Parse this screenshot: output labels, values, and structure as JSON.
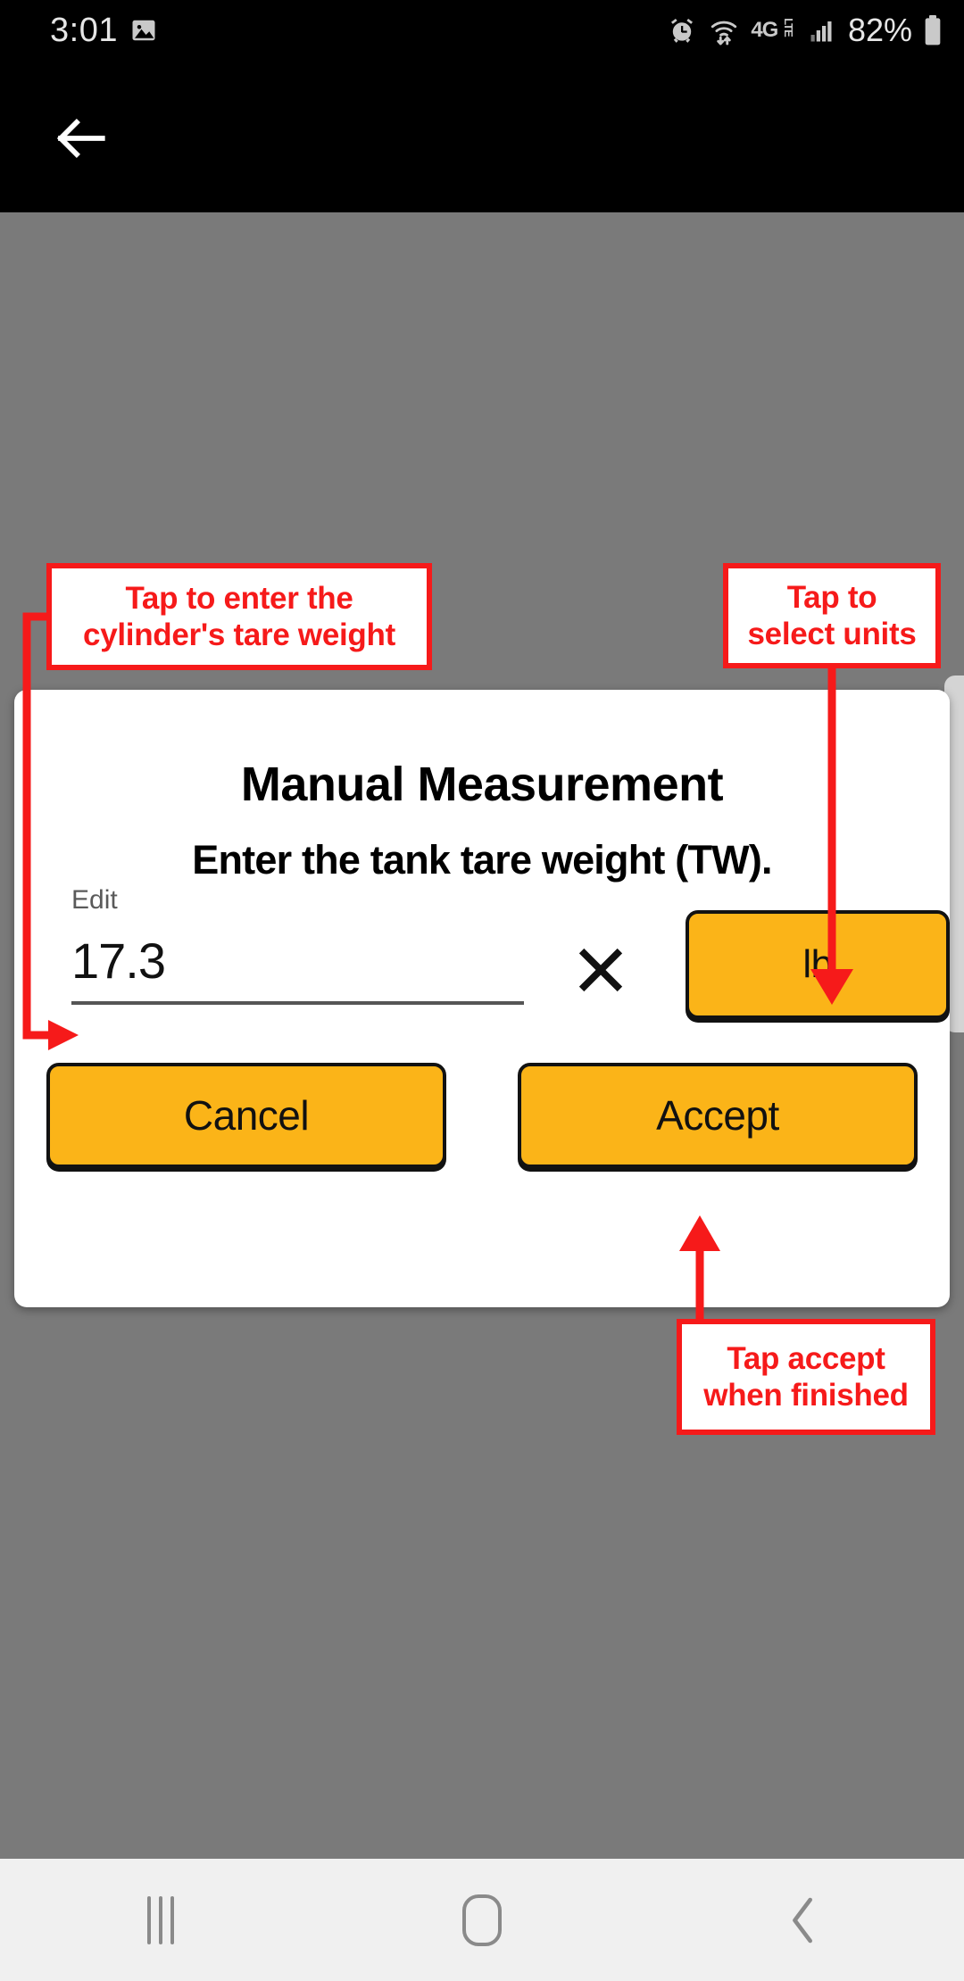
{
  "status_bar": {
    "time": "3:01",
    "battery_percent": "82%",
    "network_label": "4G",
    "network_sub": "LTE",
    "icons": [
      "image-icon",
      "alarm-icon",
      "wifi-icon",
      "network-4glte-icon",
      "signal-bars-icon",
      "battery-icon"
    ]
  },
  "app_bar": {
    "back_icon": "back-arrow-icon"
  },
  "dialog": {
    "title": "Manual Measurement",
    "subtitle": "Enter the tank tare weight (TW).",
    "field_label": "Edit",
    "field_value": "17.3",
    "field_placeholder": "",
    "clear_icon": "close-x-icon",
    "unit_value": "lb",
    "cancel_label": "Cancel",
    "accept_label": "Accept"
  },
  "annotations": {
    "left": "Tap to enter the cylinder's tare weight",
    "left_line1": "Tap to enter the",
    "left_line2": "cylinder's tare weight",
    "right_line1": "Tap to",
    "right_line2": "select units",
    "bottom_line1": "Tap accept",
    "bottom_line2": "when finished"
  },
  "nav_bar": {
    "recents_icon": "recents-icon",
    "home_icon": "home-icon",
    "back_icon": "back-chevron-icon"
  },
  "colors": {
    "accent": "#fbb418",
    "annotation": "#f61a1a",
    "backdrop": "#7a7a7a",
    "bar": "#000000",
    "nav": "#f0f0f0"
  }
}
